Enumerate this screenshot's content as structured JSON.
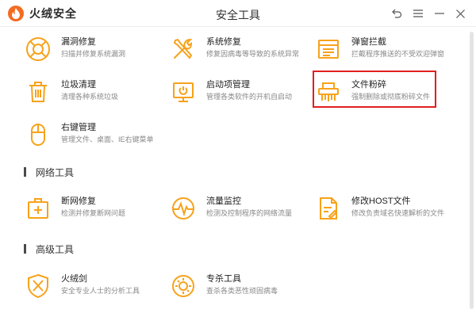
{
  "app": {
    "brand": "火绒安全",
    "window_title": "安全工具"
  },
  "sections": {
    "network": "网络工具",
    "advanced": "高级工具"
  },
  "tools": {
    "leak_repair": {
      "name": "漏洞修复",
      "desc": "扫描并修复系统漏洞"
    },
    "system_repair": {
      "name": "系统修复",
      "desc": "修复因病毒等导致的系统异常"
    },
    "popup_block": {
      "name": "弹窗拦截",
      "desc": "拦截程序推送的不受欢迎弹窗"
    },
    "junk_clean": {
      "name": "垃圾清理",
      "desc": "清理各种系统垃圾"
    },
    "startup_mgmt": {
      "name": "启动项管理",
      "desc": "管理各类软件的开机自启动"
    },
    "file_shred": {
      "name": "文件粉碎",
      "desc": "强制删除或彻底粉碎文件"
    },
    "context_menu": {
      "name": "右键管理",
      "desc": "管理文件、桌面、IE右键菜单"
    },
    "net_repair": {
      "name": "断网修复",
      "desc": "检测并修复断网问题"
    },
    "traffic_monitor": {
      "name": "流量监控",
      "desc": "检测及控制程序的网络流量"
    },
    "host_edit": {
      "name": "修改HOST文件",
      "desc": "修改负责域名快速解析的文件"
    },
    "huorong_sword": {
      "name": "火绒剑",
      "desc": "安全专业人士的分析工具"
    },
    "special_kill": {
      "name": "专杀工具",
      "desc": "查杀各类恶性顽固病毒"
    }
  },
  "colors": {
    "accent": "#f7a21b",
    "brand": "#f36b21",
    "highlight": "#e01f1f"
  },
  "icons": {
    "window": [
      "back-icon",
      "menu-icon",
      "minimize-icon",
      "close-icon"
    ]
  }
}
